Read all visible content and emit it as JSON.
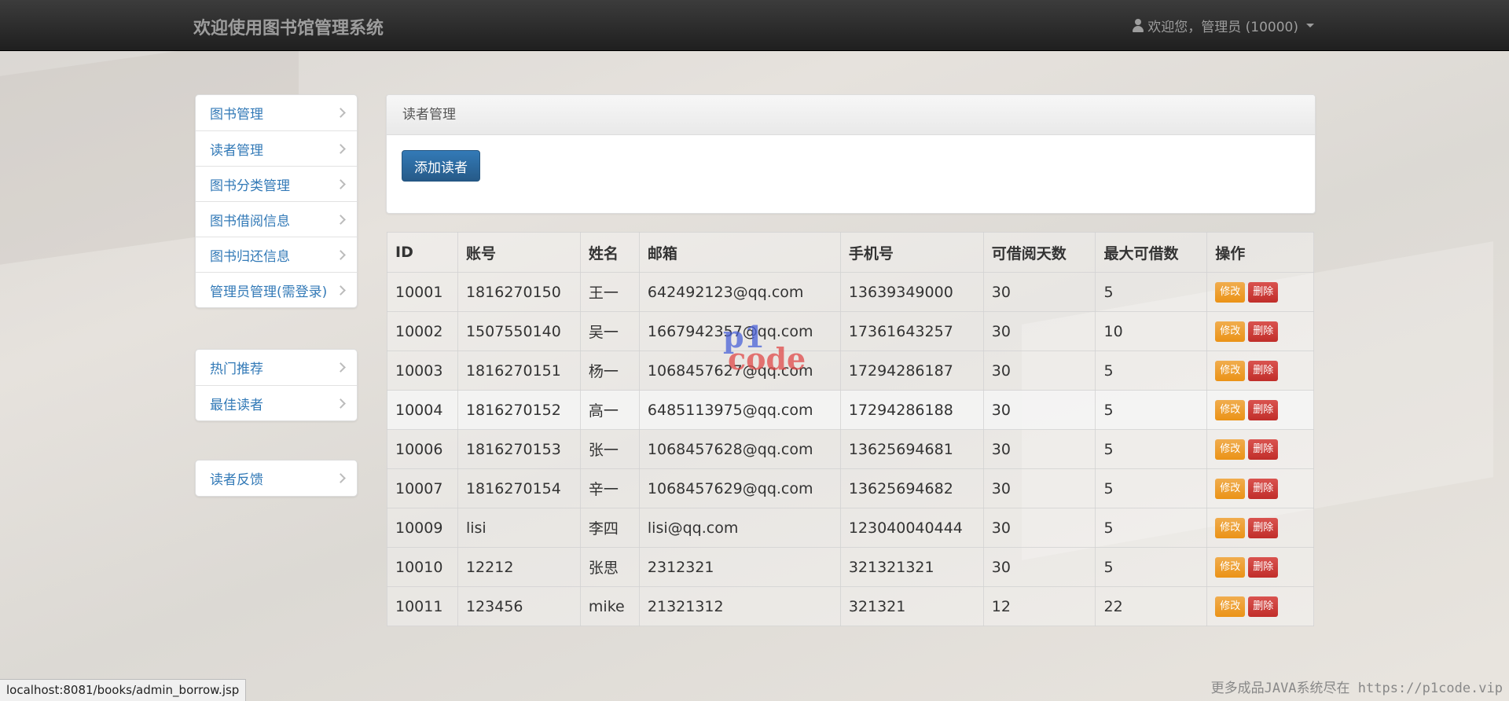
{
  "navbar": {
    "brand": "欢迎使用图书馆管理系统",
    "user_greeting": "欢迎您，管理员 (10000)"
  },
  "sidebar": {
    "group1": [
      {
        "label": "图书管理"
      },
      {
        "label": "读者管理"
      },
      {
        "label": "图书分类管理"
      },
      {
        "label": "图书借阅信息"
      },
      {
        "label": "图书归还信息"
      },
      {
        "label": "管理员管理(需登录)"
      }
    ],
    "group2": [
      {
        "label": "热门推荐"
      },
      {
        "label": "最佳读者"
      }
    ],
    "group3": [
      {
        "label": "读者反馈"
      }
    ]
  },
  "panel": {
    "title": "读者管理",
    "add_button": "添加读者"
  },
  "table": {
    "headers": [
      "ID",
      "账号",
      "姓名",
      "邮箱",
      "手机号",
      "可借阅天数",
      "最大可借数",
      "操作"
    ],
    "edit_label": "修改",
    "delete_label": "删除",
    "rows": [
      {
        "id": "10001",
        "account": "1816270150",
        "name": "王一",
        "email": "642492123@qq.com",
        "phone": "13639349000",
        "days": "30",
        "max": "5"
      },
      {
        "id": "10002",
        "account": "1507550140",
        "name": "吴一",
        "email": "1667942357@qq.com",
        "phone": "17361643257",
        "days": "30",
        "max": "10"
      },
      {
        "id": "10003",
        "account": "1816270151",
        "name": "杨一",
        "email": "1068457627@qq.com",
        "phone": "17294286187",
        "days": "30",
        "max": "5"
      },
      {
        "id": "10004",
        "account": "1816270152",
        "name": "高一",
        "email": "6485113975@qq.com",
        "phone": "17294286188",
        "days": "30",
        "max": "5"
      },
      {
        "id": "10006",
        "account": "1816270153",
        "name": "张一",
        "email": "1068457628@qq.com",
        "phone": "13625694681",
        "days": "30",
        "max": "5"
      },
      {
        "id": "10007",
        "account": "1816270154",
        "name": "辛一",
        "email": "1068457629@qq.com",
        "phone": "13625694682",
        "days": "30",
        "max": "5"
      },
      {
        "id": "10009",
        "account": "lisi",
        "name": "李四",
        "email": "lisi@qq.com",
        "phone": "123040040444",
        "days": "30",
        "max": "5"
      },
      {
        "id": "10010",
        "account": "12212",
        "name": "张思",
        "email": "2312321",
        "phone": "321321321",
        "days": "30",
        "max": "5"
      },
      {
        "id": "10011",
        "account": "123456",
        "name": "mike",
        "email": "21321312",
        "phone": "321321",
        "days": "12",
        "max": "22"
      }
    ]
  },
  "watermark": {
    "line1": "p1",
    "line2": "code"
  },
  "status_bar": {
    "url": "localhost:8081/books/admin_borrow.jsp"
  },
  "footer_note": "更多成品JAVA系统尽在 https://p1code.vip"
}
